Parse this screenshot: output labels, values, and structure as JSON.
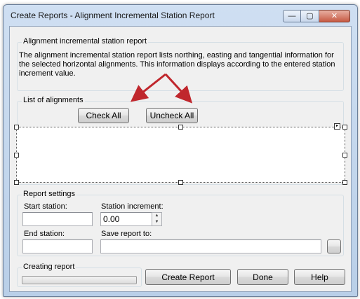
{
  "window": {
    "title": "Create Reports - Alignment Incremental Station Report",
    "minimize_glyph": "—",
    "maximize_glyph": "▢",
    "close_glyph": "✕"
  },
  "description": {
    "label": "Alignment incremental station report",
    "text": "The alignment incremental station report lists northing, easting and tangential information for the selected horizontal alignments. This information displays according to the entered station increment value."
  },
  "alignments": {
    "label": "List of alignments",
    "check_all_label": "Check All",
    "uncheck_all_label": "Uncheck All",
    "items": []
  },
  "report_settings": {
    "label": "Report settings",
    "start_station_label": "Start station:",
    "start_station_value": "",
    "station_increment_label": "Station increment:",
    "station_increment_value": "0.00",
    "end_station_label": "End station:",
    "end_station_value": "",
    "save_report_label": "Save report to:",
    "save_report_value": "",
    "browse_label": ""
  },
  "creating_report": {
    "label": "Creating report",
    "progress": 0
  },
  "actions": {
    "create_report_label": "Create Report",
    "done_label": "Done",
    "help_label": "Help"
  },
  "colors": {
    "annotation_arrow": "#c0272d"
  }
}
